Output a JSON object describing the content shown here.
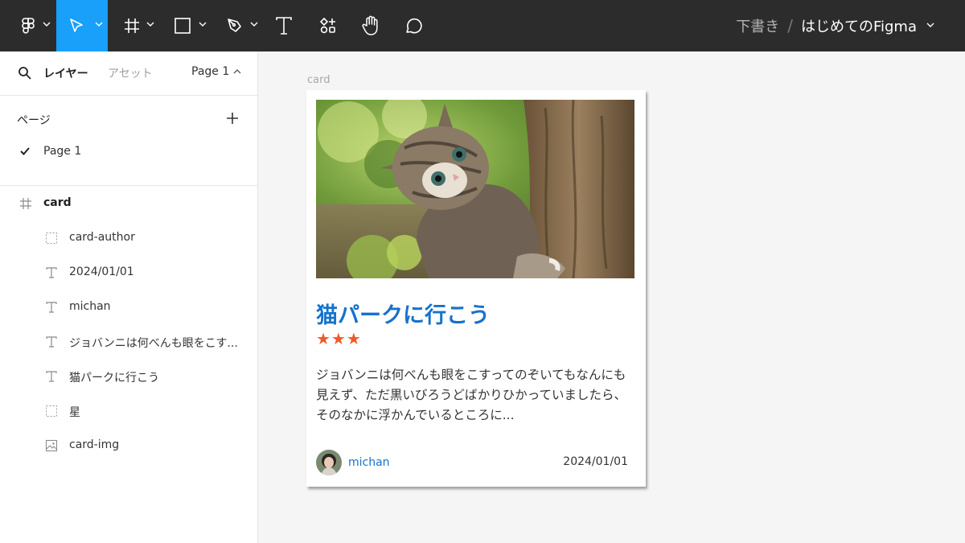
{
  "toolbar": {
    "tools": [
      "figma-menu",
      "move",
      "frame",
      "shape",
      "pen",
      "text",
      "resources",
      "hand",
      "comment"
    ],
    "active_tool": "move",
    "active_color": "#18a0fb",
    "breadcrumb": {
      "draft": "下書き",
      "separator": "/",
      "file": "はじめてのFigma"
    }
  },
  "sidebar": {
    "tab_layers": "レイヤー",
    "tab_assets": "アセット",
    "page_select": "Page 1",
    "pages_title": "ページ",
    "pages": [
      "Page 1"
    ],
    "layers": [
      {
        "name": "card",
        "icon": "frame-icon"
      },
      {
        "name": "card-author",
        "icon": "group-icon"
      },
      {
        "name": "2024/01/01",
        "icon": "text-icon"
      },
      {
        "name": "michan",
        "icon": "text-icon"
      },
      {
        "name": "ジョバンニは何べんも眼をこす...",
        "icon": "text-icon"
      },
      {
        "name": "猫パークに行こう",
        "icon": "text-icon"
      },
      {
        "name": "星",
        "icon": "group-icon"
      },
      {
        "name": "card-img",
        "icon": "image-icon"
      }
    ]
  },
  "canvas": {
    "frame_label": "card",
    "card": {
      "title": "猫パークに行こう",
      "stars": "★★★",
      "body": "ジョバンニは何べんも眼をこすってのぞいてもなんにも見えず、ただ黒いびろうどばかりひかっていましたら、そのなかに浮かんでいるところに...",
      "author": "michan",
      "date": "2024/01/01",
      "title_color": "#1672cc",
      "star_color": "#f05a28"
    }
  }
}
